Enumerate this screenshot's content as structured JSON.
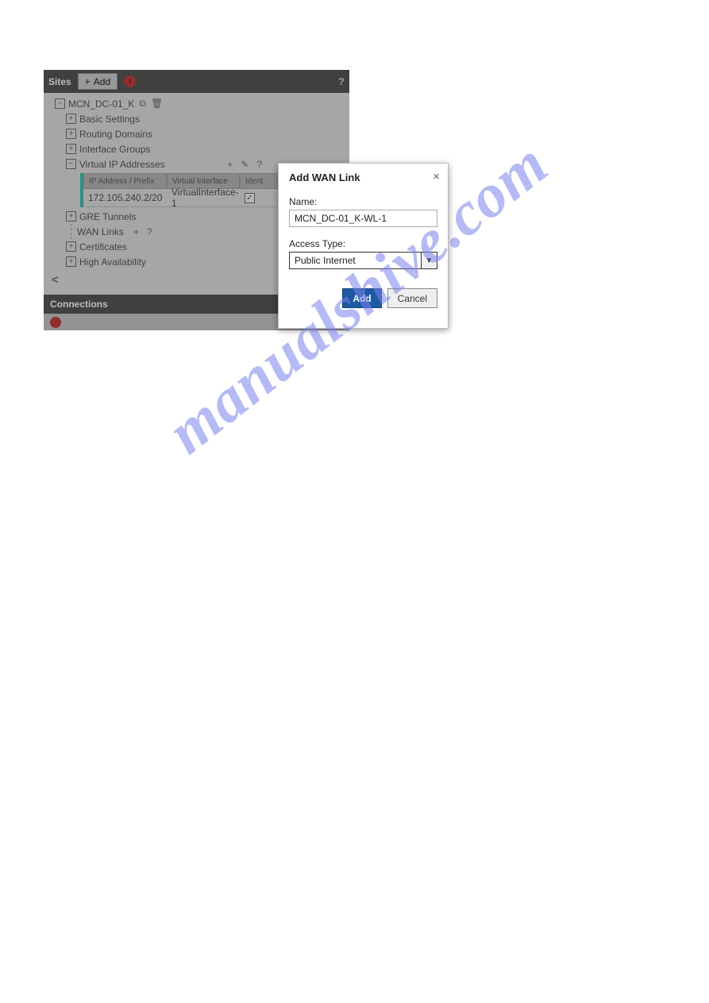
{
  "watermark": "manualshive.com",
  "panel": {
    "header_title": "Sites",
    "add_label": "Add",
    "help": "?",
    "site_name": "MCN_DC-01_K",
    "nodes": {
      "basic": "Basic Settings",
      "routing": "Routing Domains",
      "ifgroups": "Interface Groups",
      "vip": "Virtual IP Addresses",
      "gre": "GRE Tunnels",
      "wan": "WAN Links",
      "certs": "Certificates",
      "ha": "High Availability"
    },
    "vip_actions": {
      "add": "+",
      "edit": "✎",
      "help": "?"
    },
    "wan_actions": {
      "add": "+",
      "help": "?"
    },
    "table": {
      "headers": {
        "ip": "IP Address / Prefix",
        "vif": "Virtual Interface",
        "ident": "Ident"
      },
      "row": {
        "ip": "172.105.240.2/20",
        "vif": "VirtualInterface-1"
      }
    },
    "section_bar": "Connections"
  },
  "dialog": {
    "title": "Add WAN Link",
    "name_label": "Name:",
    "name_value": "MCN_DC-01_K-WL-1",
    "access_label": "Access Type:",
    "access_value": "Public Internet",
    "add_btn": "Add",
    "cancel_btn": "Cancel",
    "close": "×"
  }
}
